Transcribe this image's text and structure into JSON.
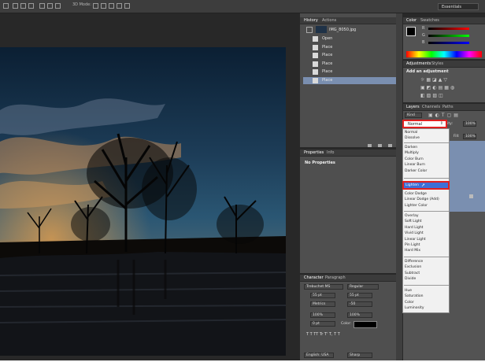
{
  "options_bar": {
    "mode_3d": "3D Mode:",
    "workspace": "Essentials"
  },
  "history": {
    "tabs": [
      "History",
      "Actions"
    ],
    "snapshot": "IMG_8050.jpg",
    "items": [
      "Open",
      "Place",
      "Place",
      "Place",
      "Place",
      "Place"
    ]
  },
  "properties": {
    "tabs": [
      "Properties",
      "Info"
    ],
    "body": "No Properties"
  },
  "color": {
    "tabs": [
      "Color",
      "Swatches"
    ],
    "channels": [
      "R",
      "G",
      "B"
    ]
  },
  "adjustments": {
    "tabs": [
      "Adjustments",
      "Styles"
    ],
    "heading": "Add an adjustment"
  },
  "layers": {
    "tabs": [
      "Layers",
      "Channels",
      "Paths"
    ],
    "kind": "Kind",
    "blend_mode": "Normal",
    "opacity_label": "pacity:",
    "opacity_value": "100%",
    "fill_label": "Fill:",
    "fill_value": "100%"
  },
  "blend_menu": {
    "group1": [
      "Normal",
      "Dissolve"
    ],
    "group2": [
      "Darken",
      "Multiply",
      "Color Burn",
      "Linear Burn",
      "Darker Color"
    ],
    "highlighted": "Lighten",
    "group3_rest": [
      "Color Dodge",
      "Linear Dodge (Add)",
      "Lighter Color"
    ],
    "group4": [
      "Overlay",
      "Soft Light",
      "Hard Light",
      "Vivid Light",
      "Linear Light",
      "Pin Light",
      "Hard Mix"
    ],
    "group5": [
      "Difference",
      "Exclusion",
      "Subtract",
      "Divide"
    ],
    "group6": [
      "Hue",
      "Saturation",
      "Color",
      "Luminosity"
    ]
  },
  "character": {
    "tabs": [
      "Character",
      "Paragraph"
    ],
    "font_family": "Trebuchet MS",
    "font_style": "Regular",
    "font_size": "55 pt",
    "leading": "55 pt",
    "kerning": "Metrics",
    "tracking": "-50",
    "vscale": "100%",
    "hscale": "100%",
    "baseline": "0 pt",
    "color_label": "Color:",
    "style_buttons": "T T TT Tr T' T, T T",
    "language": "English: USA",
    "antialias": "Sharp"
  },
  "colors": {
    "panel": "#535353",
    "highlight": "#3d6fd6",
    "callout": "#e02020",
    "selected_row": "#7a8fb0"
  }
}
